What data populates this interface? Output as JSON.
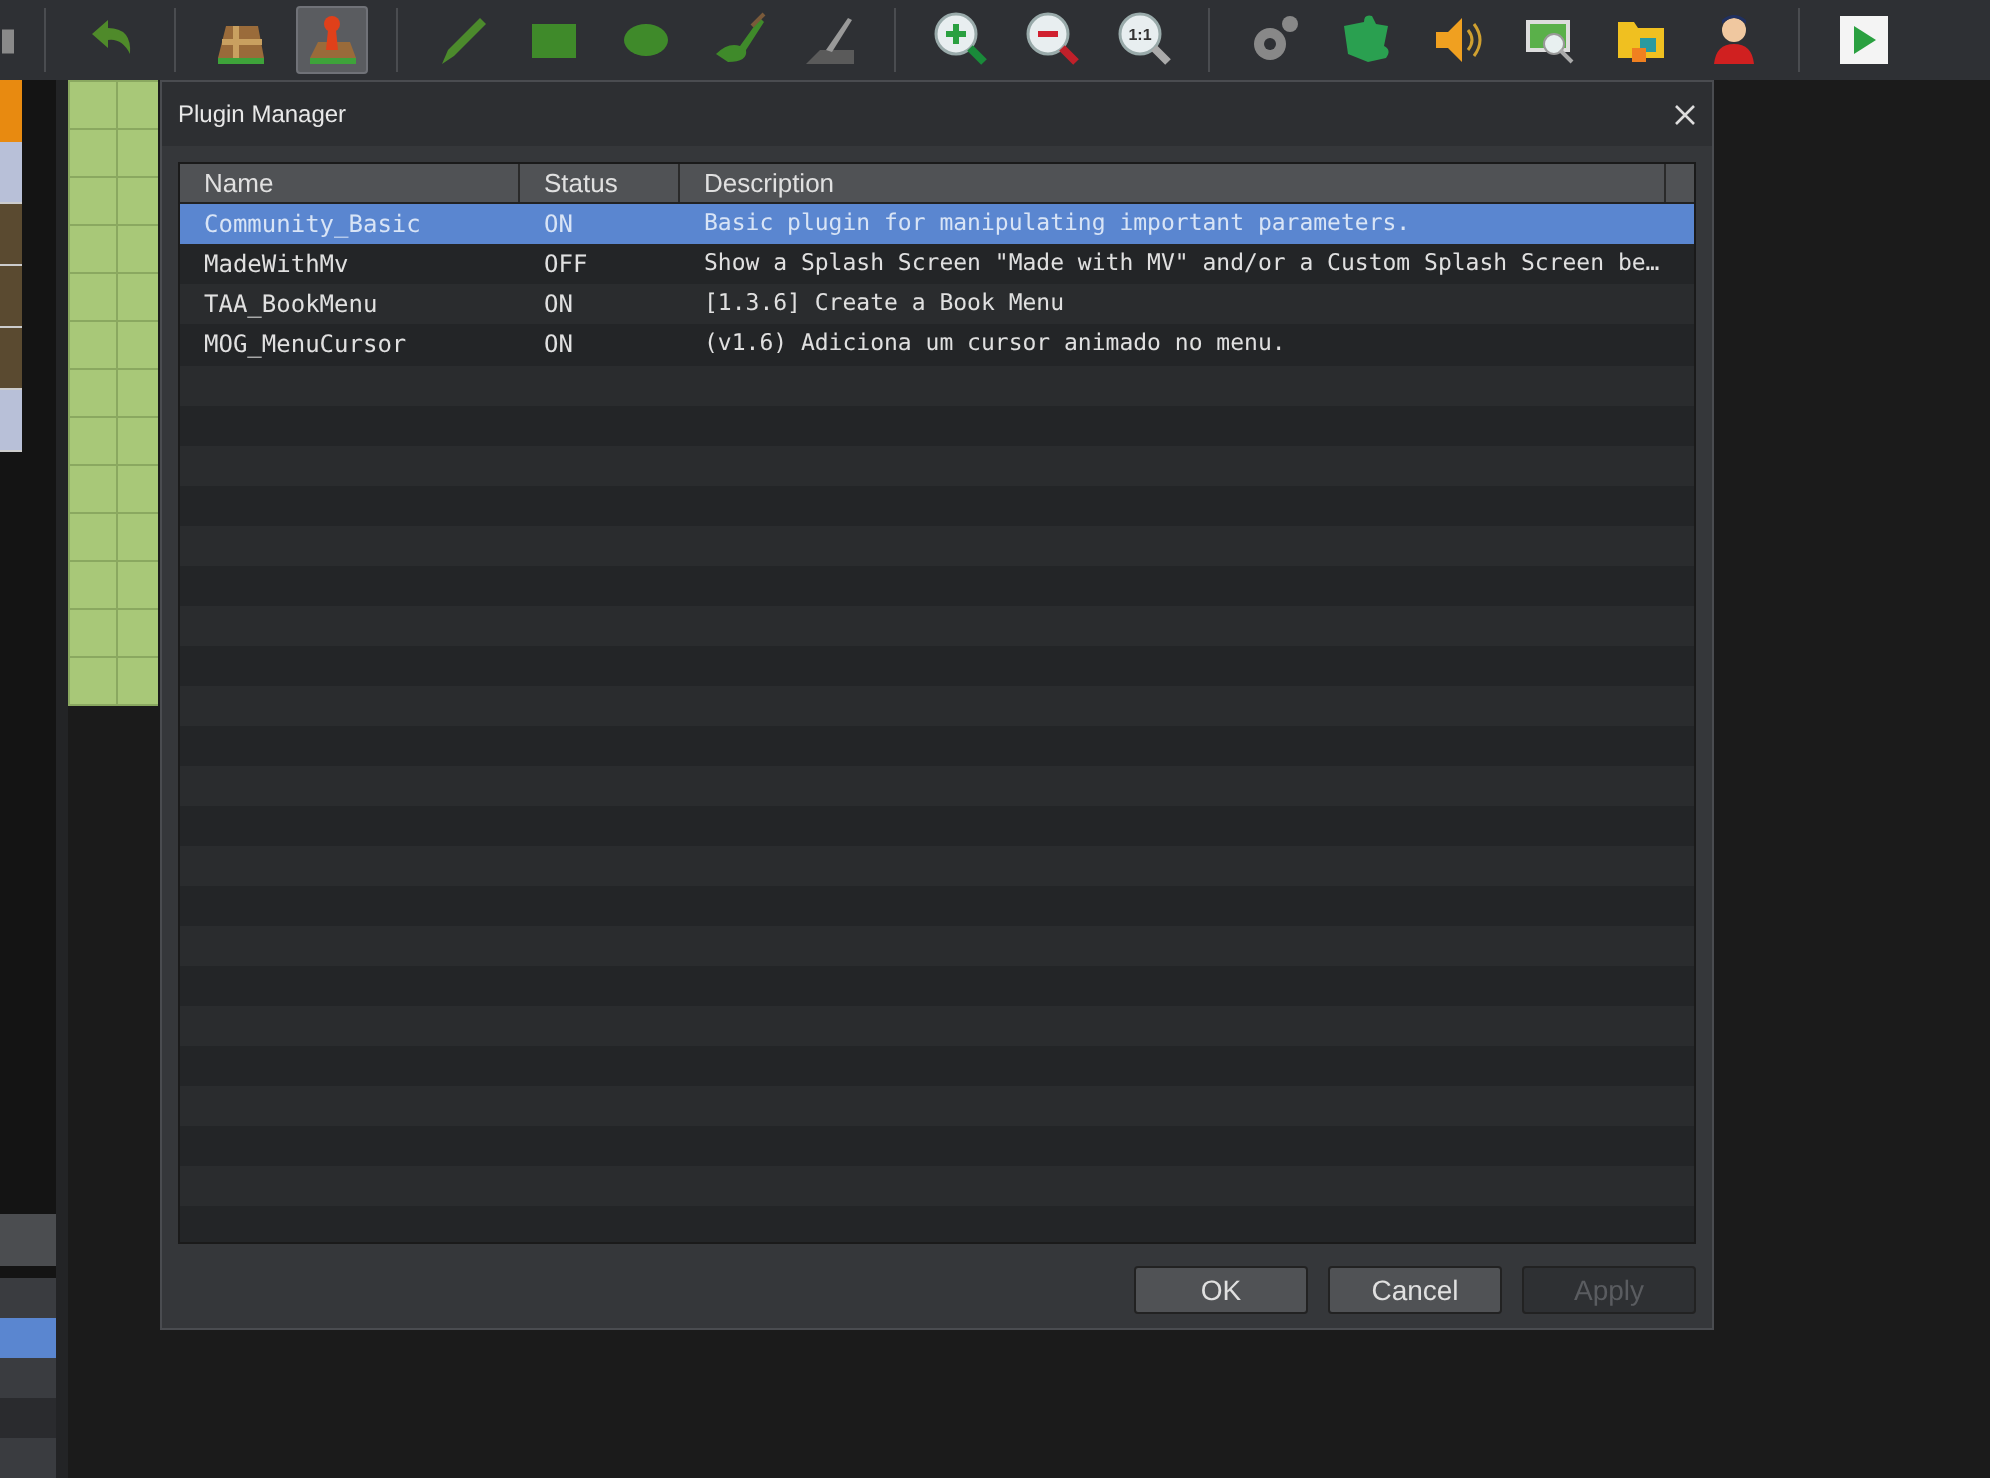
{
  "toolbar": {
    "tools": [
      {
        "kind": "partial",
        "selected": false
      },
      {
        "kind": "sep"
      },
      {
        "kind": "undo",
        "selected": false
      },
      {
        "kind": "sep"
      },
      {
        "kind": "map",
        "selected": false
      },
      {
        "kind": "event",
        "selected": true
      },
      {
        "kind": "sep"
      },
      {
        "kind": "pencil",
        "selected": false
      },
      {
        "kind": "rect",
        "selected": false
      },
      {
        "kind": "ellipse",
        "selected": false
      },
      {
        "kind": "fill",
        "selected": false
      },
      {
        "kind": "shadow",
        "selected": false
      },
      {
        "kind": "sep"
      },
      {
        "kind": "zoomin",
        "selected": false
      },
      {
        "kind": "zoomout",
        "selected": false
      },
      {
        "kind": "zoomreset",
        "selected": false,
        "label": "1:1"
      },
      {
        "kind": "sep"
      },
      {
        "kind": "gear",
        "selected": false
      },
      {
        "kind": "puzzle",
        "selected": false
      },
      {
        "kind": "sound",
        "selected": false
      },
      {
        "kind": "monitor",
        "selected": false
      },
      {
        "kind": "folder",
        "selected": false
      },
      {
        "kind": "person",
        "selected": false
      },
      {
        "kind": "sep"
      },
      {
        "kind": "play",
        "selected": false
      }
    ]
  },
  "left_list": [
    {
      "selected": false
    },
    {
      "selected": true
    },
    {
      "selected": false
    },
    {
      "selected": false
    },
    {
      "selected": false
    }
  ],
  "dialog": {
    "title": "Plugin Manager",
    "table": {
      "columns": [
        "Name",
        "Status",
        "Description"
      ],
      "rows": [
        {
          "name": "Community_Basic",
          "status": "ON",
          "description": "Basic plugin for manipulating important parameters.",
          "selected": true
        },
        {
          "name": "MadeWithMv",
          "status": "OFF",
          "description": "Show a Splash Screen \"Made with MV\" and/or a Custom Splash Screen be…",
          "selected": false
        },
        {
          "name": "TAA_BookMenu",
          "status": "ON",
          "description": "[1.3.6] Create a Book Menu",
          "selected": false
        },
        {
          "name": "MOG_MenuCursor",
          "status": "ON",
          "description": "(v1.6) Adiciona um cursor animado no menu.",
          "selected": false
        }
      ]
    },
    "buttons": [
      {
        "label": "OK",
        "disabled": false
      },
      {
        "label": "Cancel",
        "disabled": false
      },
      {
        "label": "Apply",
        "disabled": true
      }
    ]
  }
}
